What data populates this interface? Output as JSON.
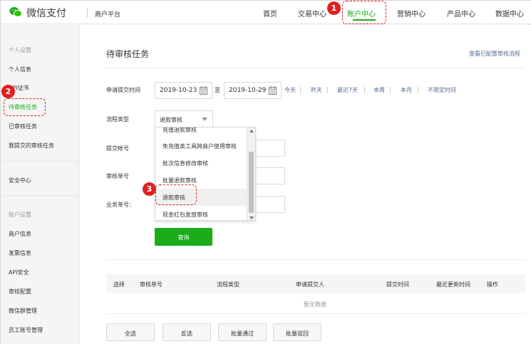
{
  "header": {
    "logo_text": "微信支付",
    "platform": "商户平台",
    "nav": [
      "首页",
      "交易中心",
      "账户中心",
      "营销中心",
      "产品中心",
      "数据中心"
    ],
    "active_nav": "账户中心",
    "accent_color": "#1aad19"
  },
  "sidebar": {
    "group1_title": "个人设置",
    "group1_items": [
      "个人信息",
      "API证书",
      "待审核任务",
      "已审核任务",
      "我提交的审核任务"
    ],
    "security": "安全中心",
    "group2_title": "账户设置",
    "group2_items": [
      "商户信息",
      "发票信息",
      "API安全",
      "审核配置",
      "微信群管理",
      "员工账号管理"
    ]
  },
  "main": {
    "title": "待审核任务",
    "config_link": "查看已配置审核流程",
    "submit_time_label": "申请提交时间",
    "date_from": "2019-10-23",
    "date_to": "2019-10-29",
    "to_label": "至",
    "quick_ranges": [
      "今天",
      "昨天",
      "最近7天",
      "本周",
      "本月",
      "不限定时间"
    ],
    "flow_type_label": "流程类型",
    "flow_type_value": "退款审核",
    "submitter_label": "提交帐号",
    "audit_no_label": "审核单号",
    "business_no_label": "业务单号：",
    "dropdown_options": [
      "充值退款审核",
      "免充值类工具跨商户使用审核",
      "批次信息修改审核",
      "批量退款审核",
      "退款审核",
      "现金红包发放审核"
    ],
    "query_button": "查询",
    "table_headers": [
      "选择",
      "审核单号",
      "流程类型",
      "申请提交人",
      "提交时间",
      "最近更新时间",
      "操作"
    ],
    "empty_text": "暂无数据",
    "footer_buttons": [
      "全选",
      "反选",
      "批量通过",
      "批量驳回"
    ]
  },
  "annotations": [
    "1",
    "2",
    "3"
  ]
}
